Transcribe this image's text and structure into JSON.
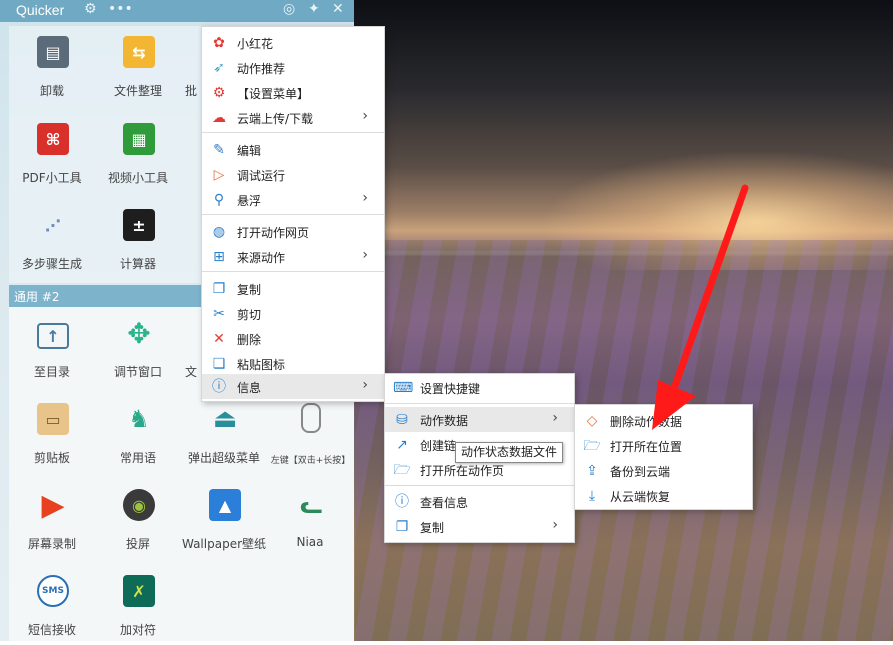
{
  "quicker": {
    "title": "Quicker",
    "section_label": "通用 #2",
    "apps_top": [
      {
        "label": "卸载",
        "icon": "uninstall-icon"
      },
      {
        "label": "文件整理",
        "icon": "file-organize-icon"
      },
      {
        "label": "批",
        "icon": "batch-icon"
      },
      {
        "label": "PDF小工具",
        "icon": "pdf-icon"
      },
      {
        "label": "视频小工具",
        "icon": "video-icon"
      },
      {
        "label": "多步骤生成",
        "icon": "multistep-icon"
      },
      {
        "label": "计算器",
        "icon": "calculator-icon"
      }
    ],
    "apps_bottom": [
      {
        "label": "至目录",
        "icon": "folder-up-icon"
      },
      {
        "label": "调节窗口",
        "icon": "move-arrows-icon"
      },
      {
        "label": "文",
        "icon": "text-icon"
      },
      {
        "label": "剪贴板",
        "icon": "clipboard-icon"
      },
      {
        "label": "常用语",
        "icon": "dinosaur-icon"
      },
      {
        "label": "弹出超级菜单",
        "icon": "eject-icon"
      },
      {
        "label": "左键【双击+长按】",
        "icon": "mouse-icon"
      },
      {
        "label": "屏幕录制",
        "icon": "play-icon"
      },
      {
        "label": "投屏",
        "icon": "android-icon"
      },
      {
        "label": "Wallpaper壁纸",
        "icon": "image-icon"
      },
      {
        "label": "Niaa",
        "icon": "cat-icon"
      },
      {
        "label": "短信接收",
        "icon": "sms-icon"
      },
      {
        "label": "加对符",
        "icon": "xing-icon"
      }
    ]
  },
  "menu_main": [
    {
      "label": "小红花",
      "icon": "flower-icon",
      "color": "#e53935"
    },
    {
      "label": "动作推荐",
      "icon": "rocket-icon",
      "color": "#3aa0c9"
    },
    {
      "label": "【设置菜单】",
      "icon": "gear-icon",
      "color": "#e53935"
    },
    {
      "label": "云端上传/下载",
      "icon": "cloud-icon",
      "color": "#e53935",
      "submenu": true
    },
    {
      "label": "编辑",
      "icon": "pencil-icon",
      "color": "#2a7fc9"
    },
    {
      "label": "调试运行",
      "icon": "play-outline-icon",
      "color": "#e8703a"
    },
    {
      "label": "悬浮",
      "icon": "hover-icon",
      "color": "#2a7fc9",
      "submenu": true
    },
    {
      "label": "打开动作网页",
      "icon": "globe-icon",
      "color": "#2a7fc9"
    },
    {
      "label": "来源动作",
      "icon": "windows-icon",
      "color": "#2a7fc9",
      "submenu": true
    },
    {
      "label": "复制",
      "icon": "copy-icon",
      "color": "#2a7fc9"
    },
    {
      "label": "剪切",
      "icon": "scissors-icon",
      "color": "#2a7fc9"
    },
    {
      "label": "删除",
      "icon": "delete-x-icon",
      "color": "#e53935"
    },
    {
      "label": "粘贴图标",
      "icon": "paste-icon",
      "color": "#2a7fc9"
    },
    {
      "label": "信息",
      "icon": "info-icon",
      "color": "#2a7fc9",
      "submenu": true
    }
  ],
  "menu_info": [
    {
      "label": "设置快捷键",
      "icon": "keyboard-icon"
    },
    {
      "label": "动作数据",
      "icon": "database-icon",
      "submenu": true
    },
    {
      "label": "创建链",
      "icon": "link-out-icon"
    },
    {
      "label": "打开所在动作页",
      "icon": "folder-open-icon"
    },
    {
      "label": "查看信息",
      "icon": "info-icon"
    },
    {
      "label": "复制",
      "icon": "copy-icon",
      "submenu": true
    }
  ],
  "menu_data": [
    {
      "label": "删除动作数据",
      "icon": "eraser-icon"
    },
    {
      "label": "打开所在位置",
      "icon": "folder-open-icon"
    },
    {
      "label": "备份到云端",
      "icon": "upload-icon"
    },
    {
      "label": "从云端恢复",
      "icon": "download-icon"
    }
  ],
  "tooltip": "动作状态数据文件"
}
